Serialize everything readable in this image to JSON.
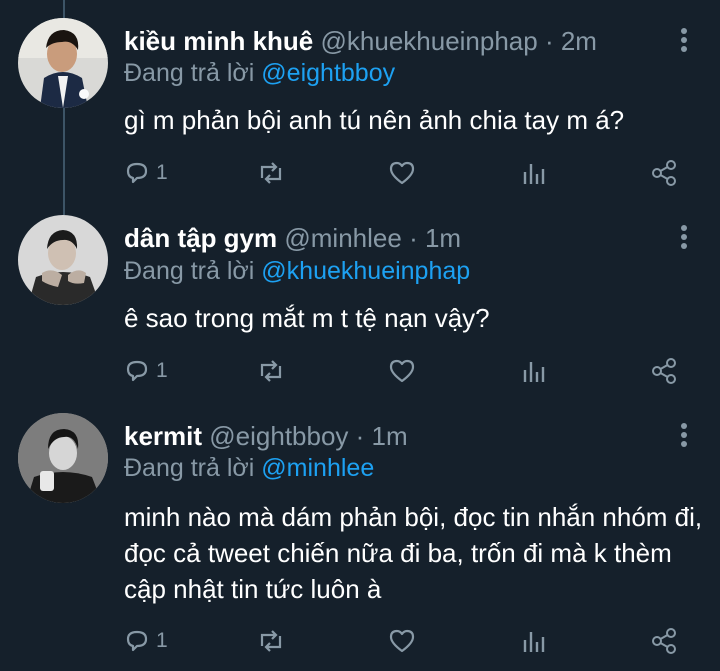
{
  "tweets": [
    {
      "display_name": "kiều minh khuê",
      "handle": "@khuekhueinphap",
      "time": "· 2m",
      "reply_prefix": "Đang trả lời",
      "reply_to": "@eightbboy",
      "text": "gì m phản bội anh tú nên ảnh chia tay m á?",
      "reply_count": "1"
    },
    {
      "display_name": "dân tập gym",
      "handle": "@minhlee",
      "time": "· 1m",
      "reply_prefix": "Đang trả lời",
      "reply_to": "@khuekhueinphap",
      "text": "ê sao trong mắt m t tệ nạn vậy?",
      "reply_count": "1"
    },
    {
      "display_name": "kermit",
      "handle": "@eightbboy",
      "time": "· 1m",
      "reply_prefix": "Đang trả lời",
      "reply_to": "@minhlee",
      "text": "minh nào mà dám phản bội, đọc tin nhắn nhóm đi, đọc cả tweet chiến nữa đi ba, trốn đi mà k thèm cập nhật tin tức luôn à",
      "reply_count": "1"
    }
  ],
  "icons": {
    "reply": "reply-icon",
    "retweet": "retweet-icon",
    "like": "heart-icon",
    "analytics": "analytics-icon",
    "share": "share-icon",
    "more": "more-vertical-icon"
  },
  "colors": {
    "background": "#15202b",
    "secondary_text": "#8899a6",
    "link": "#1da1f2",
    "thread_line": "#3d5466"
  }
}
